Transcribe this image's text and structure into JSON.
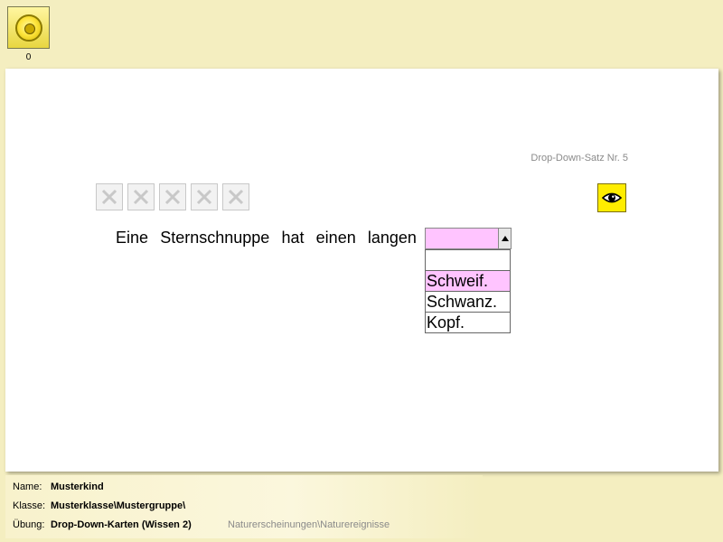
{
  "top": {
    "counter": "0",
    "coin_icon": "coin-icon"
  },
  "task": {
    "satz_label": "Drop-Down-Satz Nr. 5",
    "box_icon": "x-box-icon",
    "eye_icon": "eye-icon"
  },
  "sentence": {
    "words": [
      "Eine",
      "Sternschnuppe",
      "hat",
      "einen",
      "langen"
    ]
  },
  "dropdown": {
    "value": "",
    "options": [
      "",
      "Schweif.",
      "Schwanz.",
      "Kopf."
    ],
    "selected_index": 1,
    "highlight_color": "#ffc4ff"
  },
  "footer": {
    "name_label": "Name:",
    "name": "Musterkind",
    "klasse_label": "Klasse:",
    "klasse": "Musterklasse\\Mustergruppe\\",
    "uebung_label": "Übung:",
    "uebung": "Drop-Down-Karten (Wissen 2)",
    "category": "Naturerscheinungen\\Naturereignisse"
  }
}
